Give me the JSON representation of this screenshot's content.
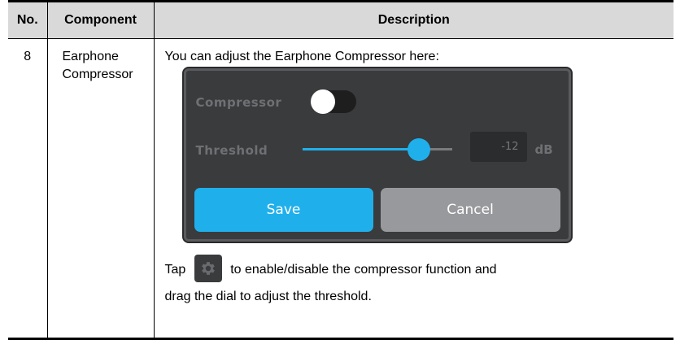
{
  "table": {
    "headers": {
      "no": "No.",
      "component": "Component",
      "description": "Description"
    },
    "row": {
      "no": "8",
      "component_line1": "Earphone",
      "component_line2": "Compressor",
      "intro": "You can adjust the Earphone Compressor here:",
      "tap_prefix": "Tap",
      "tap_suffix": "to enable/disable the compressor function and",
      "tap_line2": "drag the dial to adjust the threshold."
    }
  },
  "panel": {
    "compressor_label": "Compressor",
    "compressor_enabled": false,
    "threshold_label": "Threshold",
    "threshold_slider_fraction": 0.78,
    "threshold_value": "-12",
    "threshold_unit": "dB",
    "save_label": "Save",
    "cancel_label": "Cancel"
  },
  "icons": {
    "settings": "gear-icon"
  },
  "colors": {
    "accent": "#1fb0ec",
    "panel_bg": "#3a3b3d",
    "cancel_bg": "#98999c",
    "header_bg": "#d9d9d9"
  }
}
